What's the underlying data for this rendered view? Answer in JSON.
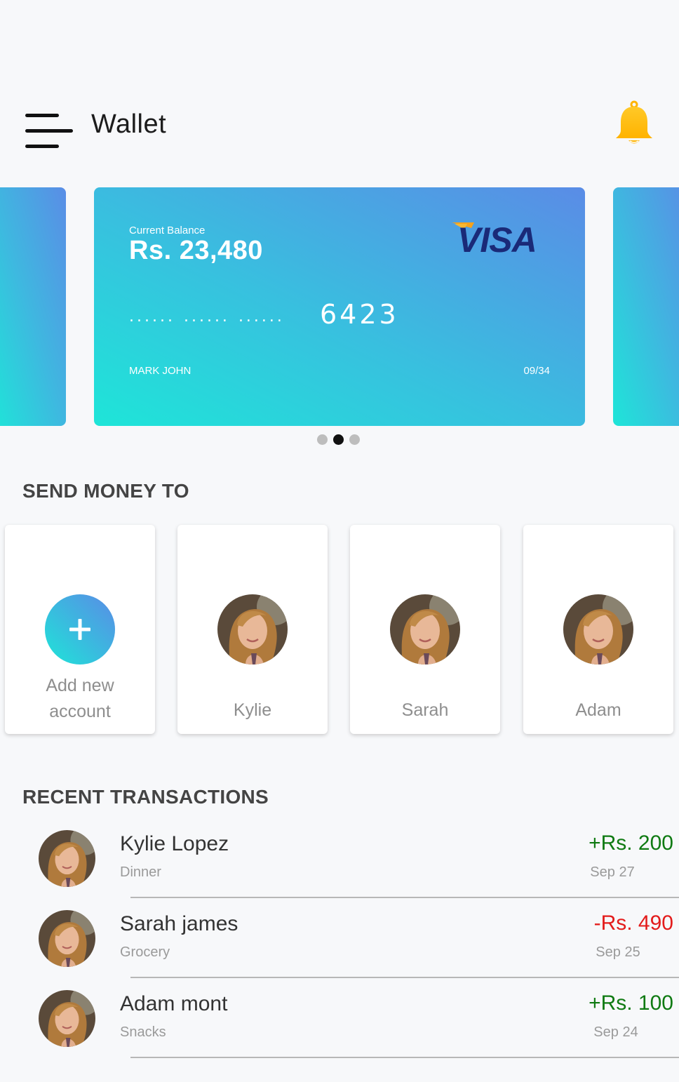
{
  "header": {
    "title": "Wallet",
    "menu_icon": "hamburger-menu-icon",
    "bell_icon": "bell-icon",
    "bell_color": "#ffbe1a"
  },
  "card": {
    "balance_label": "Current Balance",
    "balance": "Rs. 23,480",
    "brand": "VISA",
    "masked_groups": [
      "......",
      "......",
      "......"
    ],
    "last4": "6423",
    "holder": "MARK JOHN",
    "expiry": "09/34",
    "gradient": [
      "#1ee5d8",
      "#5a8ce6"
    ]
  },
  "carousel": {
    "dot_count": 3,
    "active_index": 1
  },
  "send_money": {
    "title": "SEND MONEY TO",
    "add_label_line1": "Add new",
    "add_label_line2": "account",
    "contacts": [
      {
        "name": "Kylie"
      },
      {
        "name": "Sarah"
      },
      {
        "name": "Adam"
      }
    ]
  },
  "transactions": {
    "title": "RECENT TRANSACTIONS",
    "items": [
      {
        "name": "Kylie Lopez",
        "category": "Dinner",
        "amount": "+Rs. 200",
        "date": "Sep 27",
        "type": "credit"
      },
      {
        "name": "Sarah james",
        "category": "Grocery",
        "amount": "-Rs. 490",
        "date": "Sep 25",
        "type": "debit"
      },
      {
        "name": "Adam mont",
        "category": "Snacks",
        "amount": "+Rs. 100",
        "date": "Sep 24",
        "type": "credit"
      }
    ],
    "credit_color": "#0f7a12",
    "debit_color": "#e31b1b"
  }
}
